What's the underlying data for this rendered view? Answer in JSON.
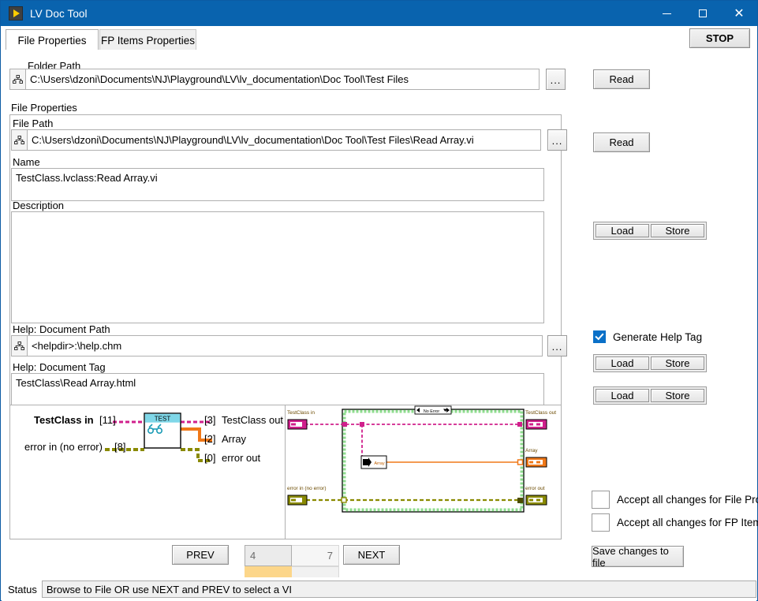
{
  "window": {
    "title": "LV Doc Tool",
    "icon": "labview-run-arrow-icon",
    "minimize": "—",
    "maximize": "□",
    "close": "✕"
  },
  "tabs": [
    {
      "label": "File Properties",
      "active": true
    },
    {
      "label": "FP Items Properties",
      "active": false
    }
  ],
  "stop_button": {
    "label": "STOP"
  },
  "folder": {
    "label": "Folder Path",
    "value": "C:\\Users\\dzoni\\Documents\\NJ\\Playground\\LV\\lv_documentation\\Doc Tool\\Test Files",
    "browse_label": "...",
    "read_label": "Read"
  },
  "file_properties": {
    "section_label": "File Properties",
    "file_path": {
      "label": "File Path",
      "value": "C:\\Users\\dzoni\\Documents\\NJ\\Playground\\LV\\lv_documentation\\Doc Tool\\Test Files\\Read Array.vi",
      "browse_label": "...",
      "read_label": "Read"
    },
    "name": {
      "label": "Name",
      "value": "TestClass.lvclass:Read Array.vi"
    },
    "description": {
      "label": "Description",
      "value": ""
    },
    "description_actions": {
      "load": "Load",
      "store": "Store"
    },
    "help_document_path": {
      "label": "Help: Document Path",
      "value": "<helpdir>:\\help.chm",
      "browse_label": "...",
      "load": "Load",
      "store": "Store"
    },
    "help_document_tag": {
      "label": "Help: Document Tag",
      "value": "TestClass\\Read Array.html",
      "load": "Load",
      "store": "Store"
    }
  },
  "generate_help_tag": {
    "label": "Generate Help Tag",
    "checked": true
  },
  "accept_file_props": {
    "label": "Accept all changes for File Props",
    "checked": false
  },
  "accept_fp_items": {
    "label": "Accept all changes for FP Items",
    "checked": false
  },
  "save_button": {
    "label": "Save changes to file"
  },
  "connector_pane": {
    "icon_label": "TEST",
    "inputs": [
      {
        "name": "TestClass in",
        "terminal": "[11]",
        "bold": true
      },
      {
        "name": "error in (no error)",
        "terminal": "[8]",
        "bold": false
      }
    ],
    "outputs": [
      {
        "terminal": "[3]",
        "name": "TestClass out"
      },
      {
        "terminal": "[2]",
        "name": "Array"
      },
      {
        "terminal": "[0]",
        "name": "error out"
      }
    ]
  },
  "block_diagram": {
    "case_selector": "No Error",
    "terminals": [
      {
        "name": "TestClass in",
        "type": "class"
      },
      {
        "name": "TestClass out",
        "type": "class"
      },
      {
        "name": "Array",
        "type": "array"
      },
      {
        "name": "error in (no error)",
        "type": "error"
      },
      {
        "name": "error out",
        "type": "error"
      }
    ],
    "node_label": "Array",
    "wire_colors": {
      "class": "#d0208c",
      "array": "#f07818",
      "error": "#8a8a00",
      "structure": "#7ec87e"
    }
  },
  "navigation": {
    "prev": "PREV",
    "next": "NEXT",
    "current": "4",
    "total": "7"
  },
  "status": {
    "label": "Status",
    "message": "Browse to File OR use NEXT and PREV to select a VI"
  }
}
